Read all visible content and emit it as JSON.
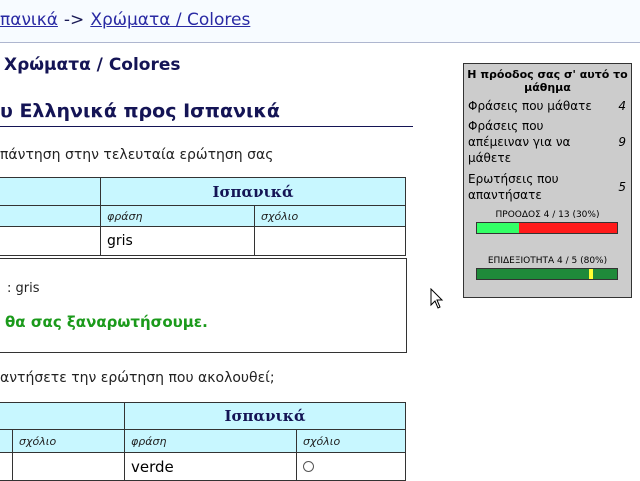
{
  "breadcrumb": {
    "part1": "πανικά",
    "separator": "->",
    "part2": "Χρώματα / Colores"
  },
  "lesson_title": "Χρώματα / Colores",
  "section_title": "υ Ελληνικά προς Ισπανικά",
  "prompt_last_answer": "πάντηση στην τελευταία ερώτηση σας",
  "table1": {
    "header_spanish": "Ισπανικά",
    "col_phrase": "φράση",
    "col_comment": "σχόλιο",
    "row_phrase": "gris",
    "row_comment": ""
  },
  "answer": {
    "line": ": gris",
    "feedback": "θα σας ξαναρωτήσουμε."
  },
  "prompt_next": "αντήσετε την ερώτηση που ακολουθεί;",
  "table2": {
    "header_spanish": "Ισπανικά",
    "col_comment_left": "σχόλιο",
    "col_phrase": "φράση",
    "col_comment": "σχόλιο",
    "row_phrase": "verde"
  },
  "progress_panel": {
    "title": "Η πρόοδος σας σ' αυτό το μάθημα",
    "stats": [
      {
        "label": "Φράσεις που μάθατε",
        "value": "4"
      },
      {
        "label": "Φράσεις που απέμειναν για να μάθετε",
        "value": "9"
      },
      {
        "label": "Ερωτήσεις που απαντήσατε",
        "value": "5"
      }
    ],
    "progress_label": "ΠΡΟΟΔΟΣ 4 / 13 (30%)",
    "progress_fraction": 0.3,
    "skill_label": "ΕΠΙΔΕΞΙΟΤΗΤΑ 4 / 5 (80%)",
    "skill_fraction": 0.8
  },
  "colors": {
    "header_bg": "#c8f7ff",
    "feedback_green": "#1b9a1b",
    "link_blue": "#2929a3",
    "panel_bg": "#cccccc"
  }
}
